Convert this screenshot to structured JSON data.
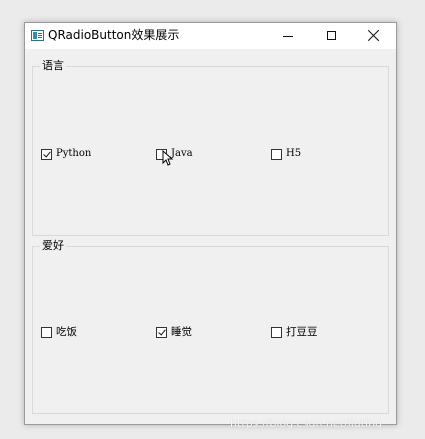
{
  "window": {
    "title": "QRadioButton效果展示"
  },
  "groups": [
    {
      "title": "语言",
      "options": [
        {
          "label": "Python",
          "checked": true
        },
        {
          "label": "Java",
          "checked": false
        },
        {
          "label": "H5",
          "checked": false
        }
      ]
    },
    {
      "title": "爱好",
      "options": [
        {
          "label": "吃饭",
          "checked": false
        },
        {
          "label": "睡觉",
          "checked": true
        },
        {
          "label": "打豆豆",
          "checked": false
        }
      ]
    }
  ],
  "watermark": "https://blog.csdn.net/liuting"
}
